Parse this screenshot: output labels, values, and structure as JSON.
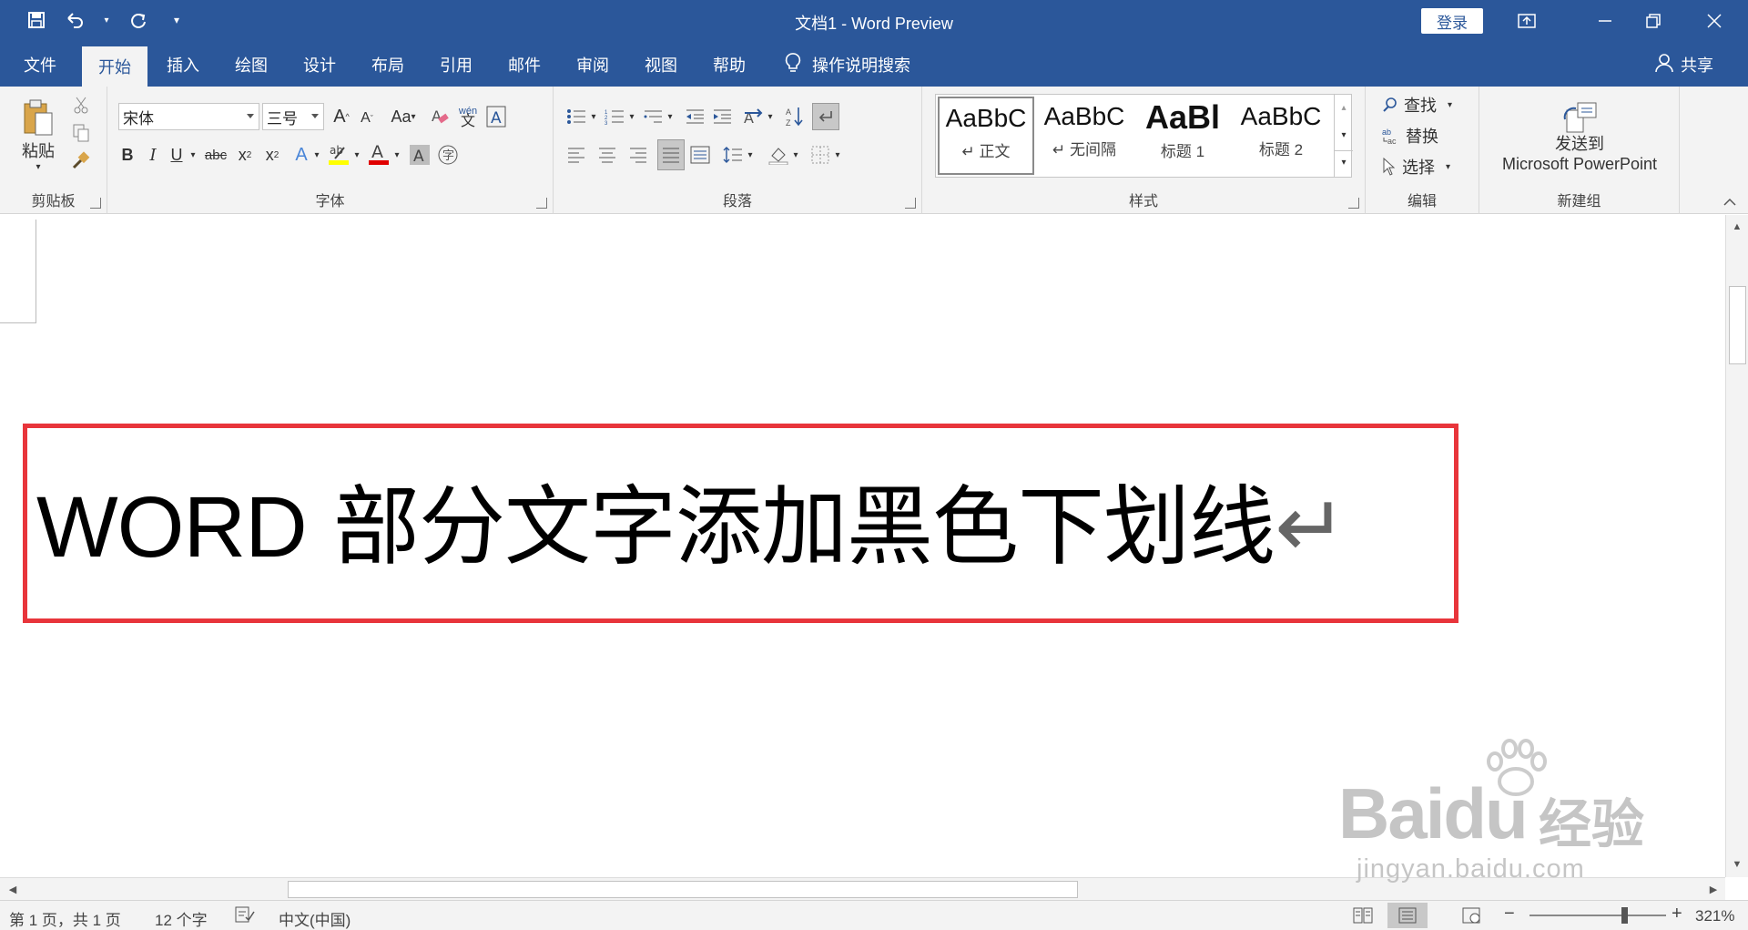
{
  "window": {
    "title": "文档1  -  Word Preview",
    "login_label": "登录"
  },
  "tabs": [
    {
      "label": "文件"
    },
    {
      "label": "开始"
    },
    {
      "label": "插入"
    },
    {
      "label": "绘图"
    },
    {
      "label": "设计"
    },
    {
      "label": "布局"
    },
    {
      "label": "引用"
    },
    {
      "label": "邮件"
    },
    {
      "label": "审阅"
    },
    {
      "label": "视图"
    },
    {
      "label": "帮助"
    }
  ],
  "tell_me": "操作说明搜索",
  "share": "共享",
  "ribbon": {
    "clipboard": {
      "paste_label": "粘贴",
      "group_label": "剪贴板"
    },
    "font": {
      "font_name": "宋体",
      "font_size": "三号",
      "change_case": "Aa",
      "group_label": "字体"
    },
    "paragraph": {
      "group_label": "段落"
    },
    "styles": {
      "items": [
        {
          "sample": "AaBbC",
          "name": "↵ 正文"
        },
        {
          "sample": "AaBbC",
          "name": "↵ 无间隔"
        },
        {
          "sample": "AaBl",
          "name": "标题 1"
        },
        {
          "sample": "AaBbC",
          "name": "标题 2"
        }
      ],
      "group_label": "样式"
    },
    "editing": {
      "find": "查找",
      "replace": "替换",
      "select": "选择",
      "group_label": "编辑"
    },
    "new_group": {
      "send_line1": "发送到",
      "send_line2": "Microsoft PowerPoint",
      "group_label": "新建组"
    }
  },
  "document": {
    "text_latin": "WORD",
    "text_cjk": " 部分文字添加黑色下划线",
    "pilcrow": "↵"
  },
  "status": {
    "pages": "第 1 页，共 1 页",
    "words": "12 个字",
    "language": "中文(中国)",
    "zoom": "321%"
  },
  "watermark": {
    "brand": "Bai",
    "brand2": "du",
    "cn": "经验",
    "url": "jingyan.baidu.com"
  },
  "colors": {
    "brand_blue": "#2b579a",
    "highlight_red": "#e8353b",
    "ribbon_bg": "#f3f3f3"
  }
}
